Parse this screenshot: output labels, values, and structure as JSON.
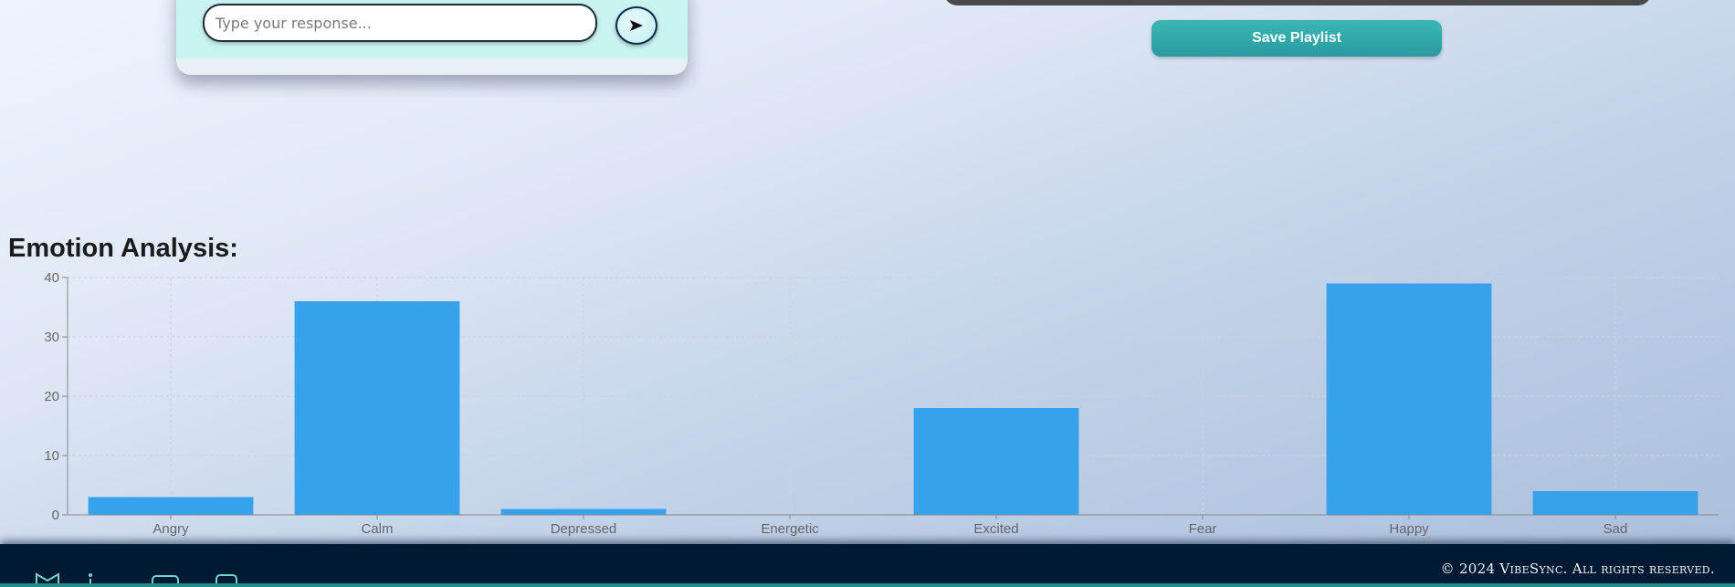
{
  "chat": {
    "input_placeholder": "Type your response...",
    "send_icon": "send-arrow-icon"
  },
  "playlist": {
    "save_label": "Save Playlist"
  },
  "analysis": {
    "title": "Emotion Analysis:"
  },
  "chart_data": {
    "type": "bar",
    "title": "",
    "xlabel": "",
    "ylabel": "",
    "categories": [
      "Angry",
      "Calm",
      "Depressed",
      "Energetic",
      "Excited",
      "Fear",
      "Happy",
      "Sad"
    ],
    "values": [
      3,
      36,
      1,
      0,
      18,
      0,
      39,
      4
    ],
    "ylim": [
      0,
      40
    ],
    "yticks": [
      0,
      10,
      20,
      30,
      40
    ],
    "bar_color": "#36a2eb",
    "grid": true
  },
  "footer": {
    "copyright": "© 2024 VibeSync. All rights reserved.",
    "icons": [
      "mail-icon",
      "info-icon",
      "chat-icon",
      "message-icon"
    ]
  },
  "colors": {
    "accent": "#2fa9a9",
    "footer_bg": "#001a33"
  }
}
